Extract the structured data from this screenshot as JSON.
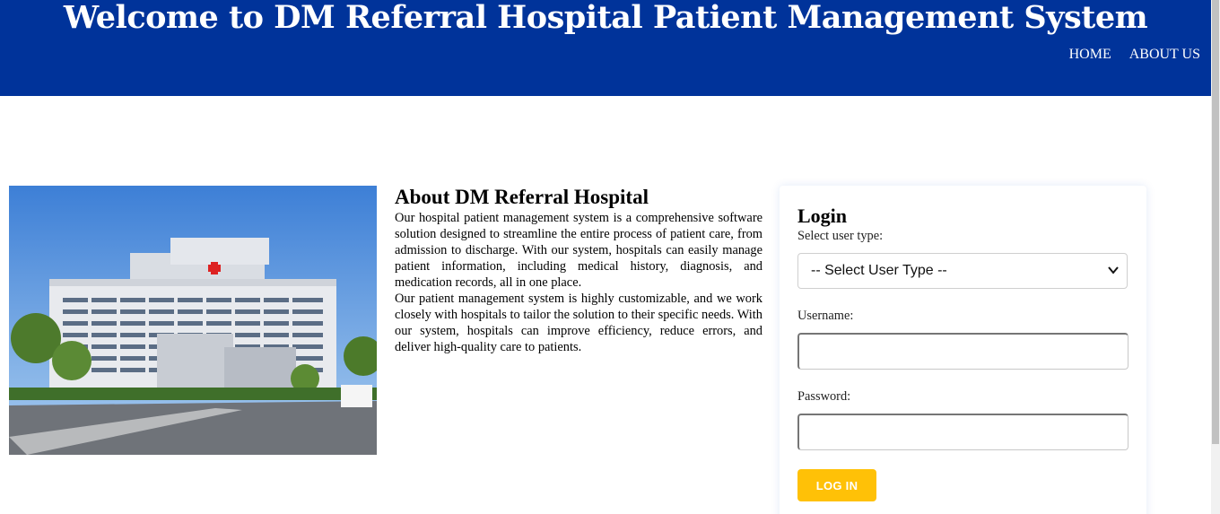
{
  "header": {
    "title": "Welcome to DM Referral Hospital Patient Management System",
    "nav": [
      "HOME",
      "ABOUT US"
    ],
    "color": "#00339a"
  },
  "about": {
    "heading": "About DM Referral Hospital",
    "paragraphs": [
      "Our hospital patient management system is a comprehensive software solution designed to streamline the entire process of patient care, from admission to discharge. With our system, hospitals can easily manage patient information, including medical history, diagnosis, and medication records, all in one place.",
      "Our patient management system is highly customizable, and we work closely with hospitals to tailor the solution to their specific needs. With our system, hospitals can improve efficiency, reduce errors, and deliver high-quality care to patients."
    ],
    "image_icon": "hospital-building-photo"
  },
  "login": {
    "title": "Login",
    "user_type_label": "Select user type:",
    "user_type_value": "-- Select User Type --",
    "username_label": "Username:",
    "password_label": "Password:",
    "button_label": "LOG IN",
    "button_color": "#ffc107"
  }
}
